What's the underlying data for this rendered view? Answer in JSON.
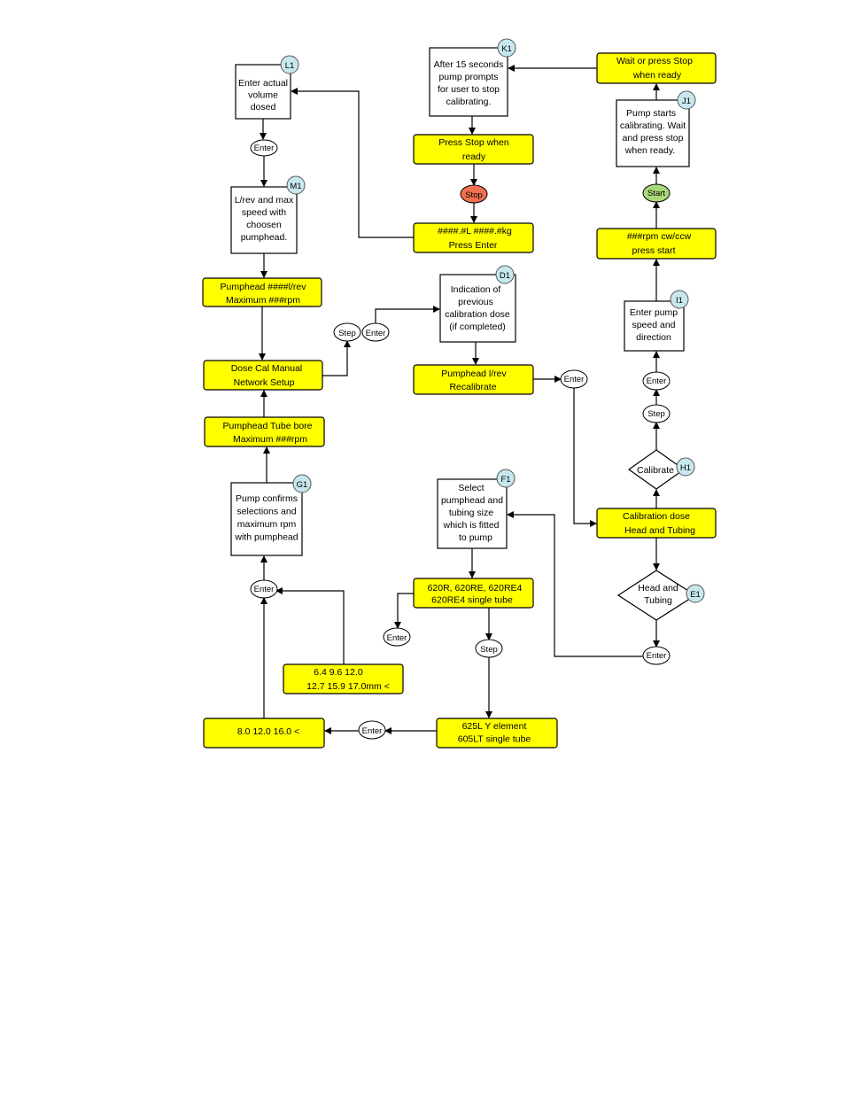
{
  "colors": {
    "display_box": "#ffff00",
    "stop_button": "#f07050",
    "start_button": "#a8d878",
    "reference_tag": "#c8e8f0"
  },
  "nodes": {
    "l1": {
      "tag": "L1",
      "lines": [
        "Enter actual",
        "volume",
        "dosed"
      ]
    },
    "m1": {
      "tag": "M1",
      "lines": [
        "L/rev and max",
        "speed with",
        "choosen",
        "pumphead."
      ]
    },
    "pumphead_lrev": {
      "lines": [
        "Pumphead ####l/rev",
        "Maximum ###rpm"
      ]
    },
    "dose_cal": {
      "lines": [
        "Dose  Cal  Manual",
        "Network Setup"
      ]
    },
    "tube_bore": {
      "lines": [
        "Pumphead    Tube bore",
        "Maximum ###rpm"
      ]
    },
    "g1": {
      "tag": "G1",
      "lines": [
        "Pump confirms",
        "selections and",
        "maximum rpm",
        "with pumphead"
      ]
    },
    "sizes_a": {
      "lines": [
        "6.4  9.6   12.0",
        "12.7   15.9    17.0mm      <"
      ]
    },
    "sizes_b": {
      "lines": [
        "8.0   12.0   16.0       <"
      ]
    },
    "y_element": {
      "lines": [
        "625L  Y element",
        "605LT single tube"
      ]
    },
    "pumphead_620": {
      "lines": [
        "620R, 620RE, 620RE4",
        "620RE4 single tube"
      ]
    },
    "f1": {
      "tag": "F1",
      "lines": [
        "Select",
        "pumphead and",
        "tubing size",
        "which is fitted",
        "to pump"
      ]
    },
    "k1": {
      "tag": "K1",
      "lines": [
        "After 15 seconds",
        "pump prompts",
        "for user to stop",
        "calibrating."
      ]
    },
    "press_stop": {
      "lines": [
        "Press Stop when",
        "ready"
      ]
    },
    "result": {
      "lines": [
        "####.#L   ####.#kg",
        "Press Enter"
      ]
    },
    "d1": {
      "tag": "D1",
      "lines": [
        "Indication of",
        "previous",
        "calibration dose",
        "(if completed)"
      ]
    },
    "recalibrate": {
      "lines": [
        "Pumphead  l/rev",
        "Recalibrate"
      ]
    },
    "wait_stop": {
      "lines": [
        "Wait or press Stop",
        "when ready"
      ]
    },
    "j1": {
      "tag": "J1",
      "lines": [
        "Pump starts",
        "calibrating. Wait",
        "and press stop",
        "when ready."
      ]
    },
    "rpm_dir": {
      "lines": [
        "###rpm  cw/ccw",
        "press start"
      ]
    },
    "i1": {
      "tag": "I1",
      "lines": [
        "Enter pump",
        "speed and",
        "direction"
      ]
    },
    "calibrate": {
      "tag": "H1",
      "label": "Calibrate"
    },
    "calibration_dose": {
      "lines": [
        "Calibration dose",
        "Head and Tubing"
      ]
    },
    "head_tubing": {
      "tag": "E1",
      "lines": [
        "Head and",
        "Tubing"
      ]
    }
  },
  "keys": {
    "enter": "Enter",
    "step": "Step",
    "stop": "Stop",
    "start": "Start"
  }
}
